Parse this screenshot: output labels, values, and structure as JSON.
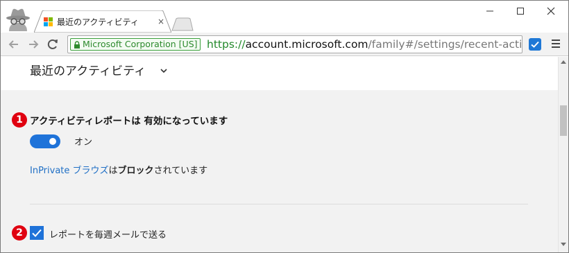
{
  "browser": {
    "tab": {
      "title": "最近のアクティビティ",
      "close_glyph": "×",
      "favicon": "microsoft-logo",
      "favicon_colors": [
        "#f25022",
        "#7fba00",
        "#00a4ef",
        "#ffb900"
      ]
    },
    "window_controls": [
      "minimize-icon",
      "maximize-icon",
      "close-icon"
    ],
    "nav_icons": [
      "back-arrow-icon",
      "forward-arrow-icon",
      "reload-icon"
    ],
    "address": {
      "ev_badge": "Microsoft Corporation [US]",
      "scheme": "https://",
      "host": "account.microsoft.com",
      "path": "/family#/settings/recent-activit"
    },
    "toolbar_icons": [
      "star-icon",
      "extension-icon",
      "menu-icon"
    ],
    "accent": "#1f73d9"
  },
  "page": {
    "title": "最近のアクティビティ",
    "activity_heading": "アクティビティレポートは 有効になっています",
    "toggle": {
      "state": "on",
      "label": "オン"
    },
    "inprivate": {
      "link": "InPrivate ブラウズ",
      "middle": "は",
      "bold": "ブロック",
      "rest": "されています"
    },
    "weekly_email": {
      "checked": true,
      "label": "レポートを毎週メールで送る"
    },
    "annotations": [
      "1",
      "2"
    ],
    "annotation_color": "#e00010"
  }
}
